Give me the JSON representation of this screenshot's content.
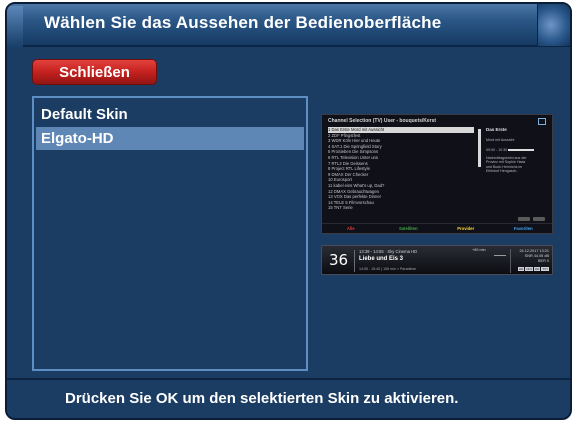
{
  "window": {
    "title": "Wählen Sie das Aussehen der Bedienoberfläche"
  },
  "toolbar": {
    "close_label": "Schließen",
    "close_color": "#c5221f"
  },
  "skins": {
    "items": [
      {
        "label": "Default Skin",
        "selected": false
      },
      {
        "label": "Elgato-HD",
        "selected": true
      }
    ]
  },
  "preview": {
    "header": "Channel Selection (TV) User - bouquets/Kerst",
    "channels": [
      "1 Das Erste  Mord mit Aussicht",
      "2 ZDF  Pfingstfest",
      "3 WDR Köln  Hier und Heute",
      "4 SAT.1  Die Springfield Story",
      "5 ProSieben  Die Simpsons",
      "6 RTL Television  Unter uns",
      "7 RTL2  Die Geissens",
      "8 Project RTL  Lifestyle",
      "9 DMAX  Der Checker",
      "10 Eurosport",
      "11 kabel eins  What's up, Dad?",
      "12 DMAX  Gebrauchtwagen",
      "13 VOX  Das perfekte Dinner",
      "14 TELE 5  Filmvorschau",
      "15 TNT  Serie"
    ],
    "info_title": "Das Erste",
    "info_lines": [
      "Mord mit Aussicht",
      "09:00 - 10:30",
      "Nachmittagskrimi aus der",
      "Provinz mit Sophie Haas",
      "und Bodo Heinrichs im",
      "Eifeldorf Hengasch."
    ],
    "footer_buttons": [
      {
        "label": "Alle",
        "color": "#e53935"
      },
      {
        "label": "Satelliten",
        "color": "#43a047"
      },
      {
        "label": "Provider",
        "color": "#fdd835"
      },
      {
        "label": "Favoriten",
        "color": "#42a5f5"
      }
    ]
  },
  "infobar": {
    "channel_number": "36",
    "line1": "13:39 - 14:55  ·  Sky Cinema HD",
    "title": "Liebe und Eis 3",
    "line3": "14:55 - 15:40  |  106 min  > Paradiese",
    "signal": "+89 min",
    "date": "24.12.2017  13:21",
    "info_a": "SNR  44.05 dB",
    "info_b": "BER  0",
    "badges": [
      "HD",
      "16:9",
      "DD",
      "TXT"
    ]
  },
  "status": {
    "message": "Drücken Sie OK um den selektierten Skin zu aktivieren."
  }
}
